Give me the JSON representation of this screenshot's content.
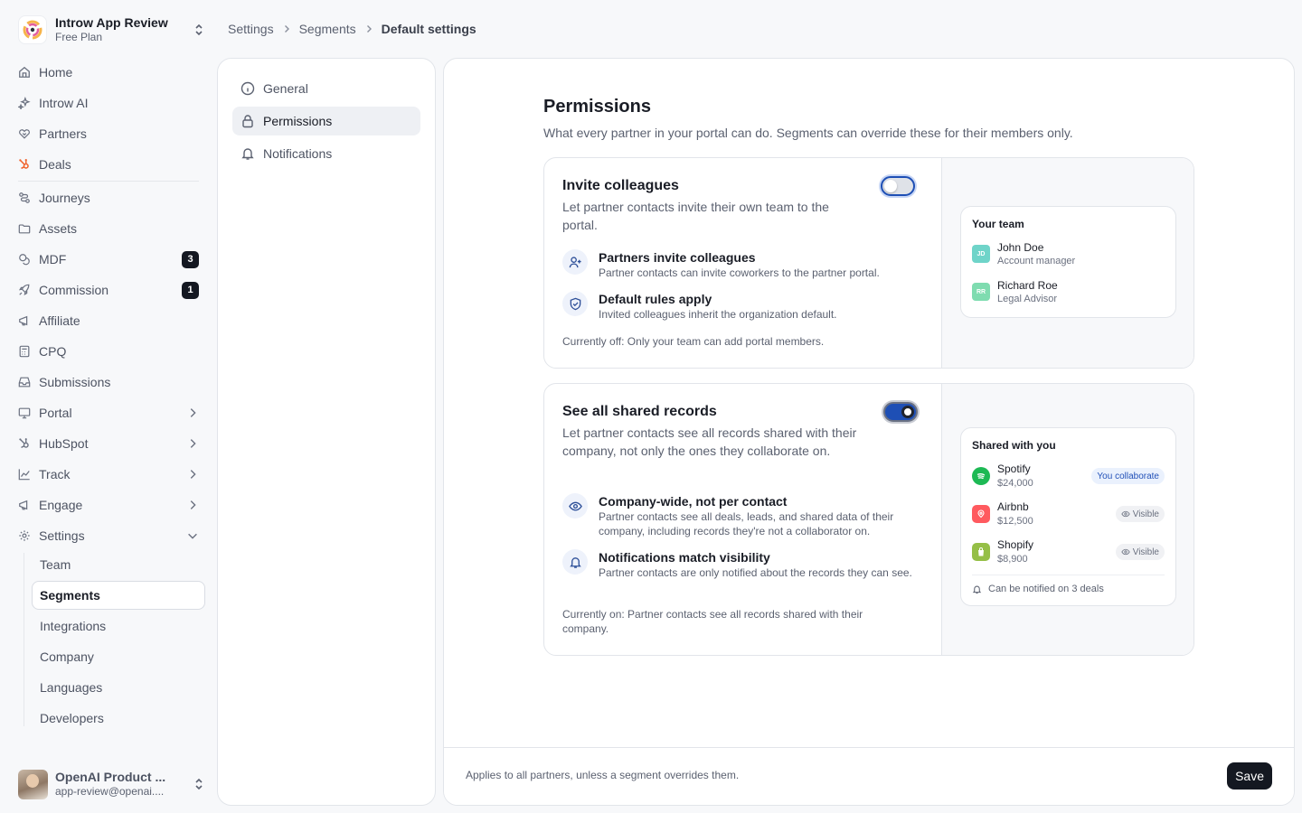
{
  "org": {
    "name": "Introw App Review",
    "plan": "Free Plan"
  },
  "nav": {
    "items": [
      {
        "label": "Home",
        "icon": "home-icon"
      },
      {
        "label": "Introw AI",
        "icon": "sparkle-icon"
      },
      {
        "label": "Partners",
        "icon": "handshake-icon"
      },
      {
        "label": "Deals",
        "icon": "hubspot-icon"
      },
      {
        "label": "Journeys",
        "icon": "journey-icon"
      },
      {
        "label": "Assets",
        "icon": "folder-icon"
      },
      {
        "label": "MDF",
        "icon": "coins-icon",
        "badge": "3"
      },
      {
        "label": "Commission",
        "icon": "rocket-icon",
        "badge": "1"
      },
      {
        "label": "Affiliate",
        "icon": "megaphone-icon"
      },
      {
        "label": "CPQ",
        "icon": "calculator-icon"
      },
      {
        "label": "Submissions",
        "icon": "inbox-icon"
      },
      {
        "label": "Portal",
        "icon": "monitor-icon"
      },
      {
        "label": "HubSpot",
        "icon": "hubspot-icon"
      },
      {
        "label": "Track",
        "icon": "chart-line-icon"
      },
      {
        "label": "Engage",
        "icon": "megaphone-icon"
      },
      {
        "label": "Settings",
        "icon": "gear-icon"
      }
    ],
    "settings_sub": [
      "Team",
      "Segments",
      "Integrations",
      "Company",
      "Languages",
      "Developers"
    ]
  },
  "user": {
    "name": "OpenAI Product ...",
    "email": "app-review@openai...."
  },
  "breadcrumb": [
    "Settings",
    "Segments",
    "Default settings"
  ],
  "subnav": [
    "General",
    "Permissions",
    "Notifications"
  ],
  "page": {
    "title": "Permissions",
    "description": "What every partner in your portal can do. Segments can override these for their members only."
  },
  "cards": [
    {
      "title": "Invite colleagues",
      "description": "Let partner contacts invite their own team to the portal.",
      "enabled": false,
      "features": [
        {
          "title": "Partners invite colleagues",
          "description": "Partner contacts can invite coworkers to the partner portal.",
          "icon": "user-plus-icon"
        },
        {
          "title": "Default rules apply",
          "description": "Invited colleagues inherit the organization default.",
          "icon": "shield-check-icon"
        }
      ],
      "status": "Currently off: Only your team can add portal members.",
      "preview": {
        "title": "Your team",
        "people": [
          {
            "initials": "JD",
            "name": "John Doe",
            "role": "Account manager",
            "color": "#6fd4c9"
          },
          {
            "initials": "RR",
            "name": "Richard Roe",
            "role": "Legal Advisor",
            "color": "#7fdcb0"
          }
        ]
      }
    },
    {
      "title": "See all shared records",
      "description": "Let partner contacts see all records shared with their company, not only the ones they collaborate on.",
      "enabled": true,
      "features": [
        {
          "title": "Company-wide, not per contact",
          "description": "Partner contacts see all deals, leads, and shared data of their company, including records they're not a collaborator on.",
          "icon": "eye-icon"
        },
        {
          "title": "Notifications match visibility",
          "description": "Partner contacts are only notified about the records they can see.",
          "icon": "bell-icon"
        }
      ],
      "status": "Currently on: Partner contacts see all records shared with their company.",
      "preview": {
        "title": "Shared with you",
        "records": [
          {
            "name": "Spotify",
            "amount": "$24,000",
            "tag": "You collaborate",
            "logo": "spotify-icon",
            "color": "#1db954"
          },
          {
            "name": "Airbnb",
            "amount": "$12,500",
            "tag": "Visible",
            "logo": "airbnb-icon",
            "color": "#ff5a5f"
          },
          {
            "name": "Shopify",
            "amount": "$8,900",
            "tag": "Visible",
            "logo": "shopify-icon",
            "color": "#95bf47"
          }
        ],
        "notify": "Can be notified on 3 deals"
      }
    }
  ],
  "footer": {
    "text": "Applies to all partners, unless a segment overrides them.",
    "save_label": "Save"
  }
}
